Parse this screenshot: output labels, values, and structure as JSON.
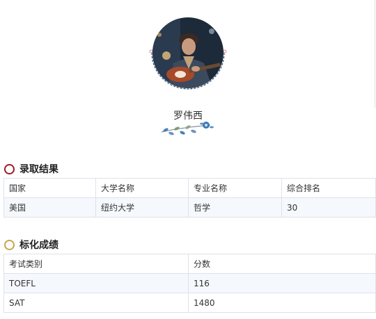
{
  "profile": {
    "name": "罗伟西",
    "avatar": "student-photo-guitar",
    "floral": "floral-ornament"
  },
  "admission": {
    "title": "录取结果",
    "headers": [
      "国家",
      "大学名称",
      "专业名称",
      "综合排名"
    ],
    "rows": [
      [
        "美国",
        "纽约大学",
        "哲学",
        "30"
      ]
    ]
  },
  "scores": {
    "title": "标化成绩",
    "headers": [
      "考试类别",
      "分数"
    ],
    "rows": [
      [
        "TOEFL",
        "116"
      ],
      [
        "SAT",
        "1480"
      ]
    ]
  },
  "colors": {
    "admission_ring": "#9b1c25",
    "scores_ring": "#c8a54a",
    "avatar_dash": "#2f4f78",
    "table_border": "#dde3ea"
  }
}
